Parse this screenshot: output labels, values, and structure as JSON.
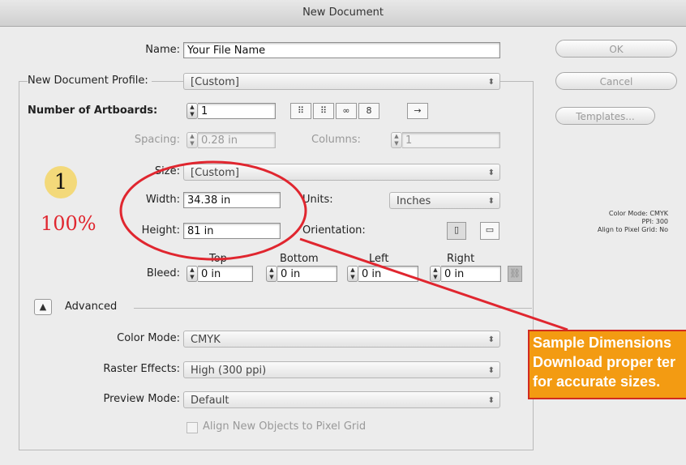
{
  "window": {
    "title": "New Document"
  },
  "buttons": {
    "ok": "OK",
    "cancel": "Cancel",
    "templates": "Templates..."
  },
  "form": {
    "name_label": "Name:",
    "name_value": "Your File Name",
    "profile_label": "New Document Profile:",
    "profile_value": "[Custom]",
    "artboards_label": "Number of Artboards:",
    "artboards_value": "1",
    "spacing_label": "Spacing:",
    "spacing_value": "0.28 in",
    "columns_label": "Columns:",
    "columns_value": "1",
    "size_label": "Size:",
    "size_value": "[Custom]",
    "width_label": "Width:",
    "width_value": "34.38 in",
    "units_label": "Units:",
    "units_value": "Inches",
    "height_label": "Height:",
    "height_value": "81 in",
    "orientation_label": "Orientation:",
    "bleed_label": "Bleed:",
    "bleed_top_label": "Top",
    "bleed_bottom_label": "Bottom",
    "bleed_left_label": "Left",
    "bleed_right_label": "Right",
    "bleed_top": "0 in",
    "bleed_bottom": "0 in",
    "bleed_left": "0 in",
    "bleed_right": "0 in",
    "advanced_label": "Advanced",
    "color_mode_label": "Color Mode:",
    "color_mode_value": "CMYK",
    "raster_label": "Raster Effects:",
    "raster_value": "High (300 ppi)",
    "preview_label": "Preview Mode:",
    "preview_value": "Default",
    "align_checkbox_label": "Align New Objects to Pixel Grid"
  },
  "info_panel": {
    "line1": "Color Mode: CMYK",
    "line2": "PPI: 300",
    "line3": "Align to Pixel Grid: No"
  },
  "annotation": {
    "number": "1",
    "percent": "100%",
    "callout_line1": "Sample Dimensions",
    "callout_line2": "Download proper ter",
    "callout_line3": "for accurate sizes.",
    "colors": {
      "ellipse": "#e0262f",
      "callout_bg": "#f39b12",
      "badge": "#f3d97a"
    }
  },
  "icons": {
    "artboard_grid_row": "grid-by-row-icon",
    "artboard_grid_col": "grid-by-column-icon",
    "artboard_row": "arrange-by-row-icon",
    "artboard_column": "arrange-by-column-icon",
    "left_to_right": "left-to-right-layout-icon",
    "portrait": "portrait-orientation-icon",
    "landscape": "landscape-orientation-icon",
    "link": "link-bleed-icon"
  }
}
